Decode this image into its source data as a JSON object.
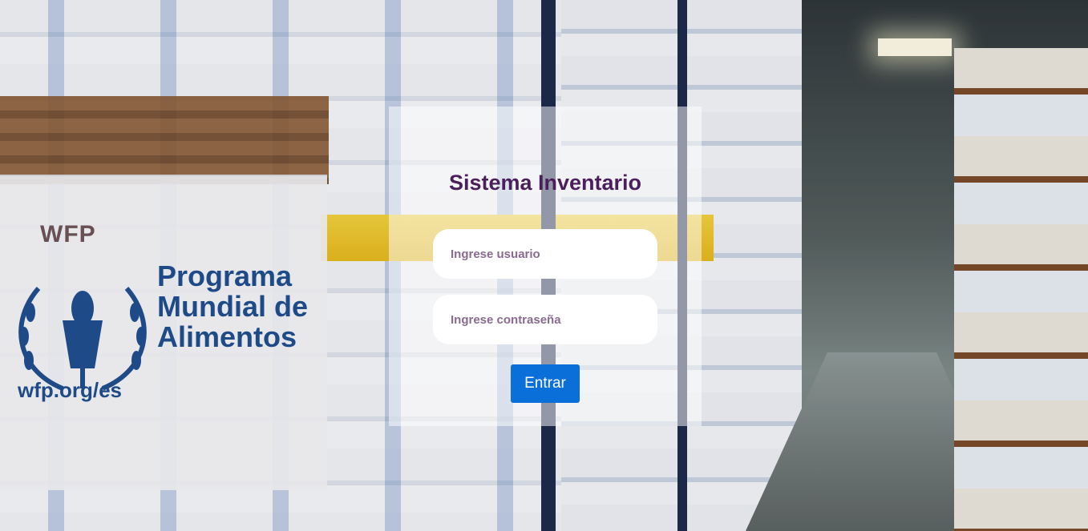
{
  "background": {
    "banner": {
      "acronym": "WFP",
      "program_name_line1": "Programa",
      "program_name_line2": "Mundial de",
      "program_name_line3": "Alimentos",
      "url": "wfp.org/es"
    }
  },
  "login": {
    "title": "Sistema Inventario",
    "username_placeholder": "Ingrese usuario",
    "password_placeholder": "Ingrese contraseña",
    "submit_label": "Entrar"
  },
  "colors": {
    "title": "#4b1e5c",
    "button": "#0a6fd9",
    "placeholder": "#8a6a90",
    "wfp_blue": "#1f4f8f"
  }
}
